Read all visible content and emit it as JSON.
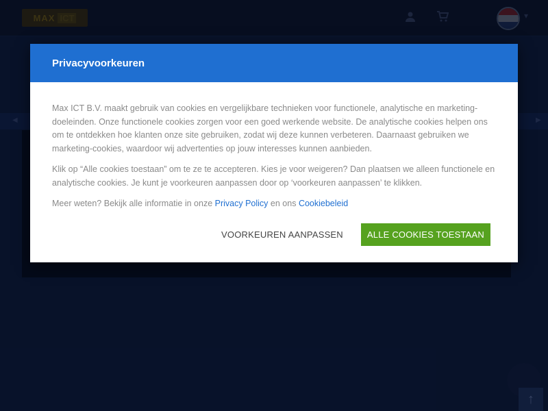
{
  "site": {
    "logo_part1": "MAX",
    "logo_part2": "ICT",
    "icons": [
      "user-icon",
      "cart-icon"
    ],
    "flag_colors": [
      "#ae1c28",
      "#ffffff",
      "#21468b"
    ]
  },
  "modal": {
    "title": "Privacyvoorkeuren",
    "paragraph1": "Max ICT B.V. maakt gebruik van cookies en vergelijkbare technieken voor functionele, analytische en marketing-doeleinden. Onze functionele cookies zorgen voor een goed werkende website. De analytische cookies helpen ons om te ontdekken hoe klanten onze site gebruiken, zodat wij deze kunnen verbeteren. Daarnaast gebruiken we marketing-cookies, waardoor wij advertenties op jouw interesses kunnen aanbieden.",
    "paragraph2": "Klik op “Alle cookies toestaan” om te ze te accepteren. Kies je voor weigeren? Dan plaatsen we alleen functionele en analytische cookies. Je kunt je voorkeuren aanpassen door op ‘voorkeuren aanpassen’ te klikken.",
    "more_info_prefix": "Meer weten? Bekijk alle informatie in onze",
    "privacy_link": "Privacy Policy",
    "more_info_mid": "en ons",
    "cookie_link": "Cookiebeleid",
    "customize_label": "VOORKEUREN AANPASSEN",
    "accept_label": "ALLE COOKIES TOESTAAN"
  },
  "colors": {
    "header_blue": "#1f6fd1",
    "accept_green": "#56a21f",
    "link_blue": "#1f6fd1"
  }
}
